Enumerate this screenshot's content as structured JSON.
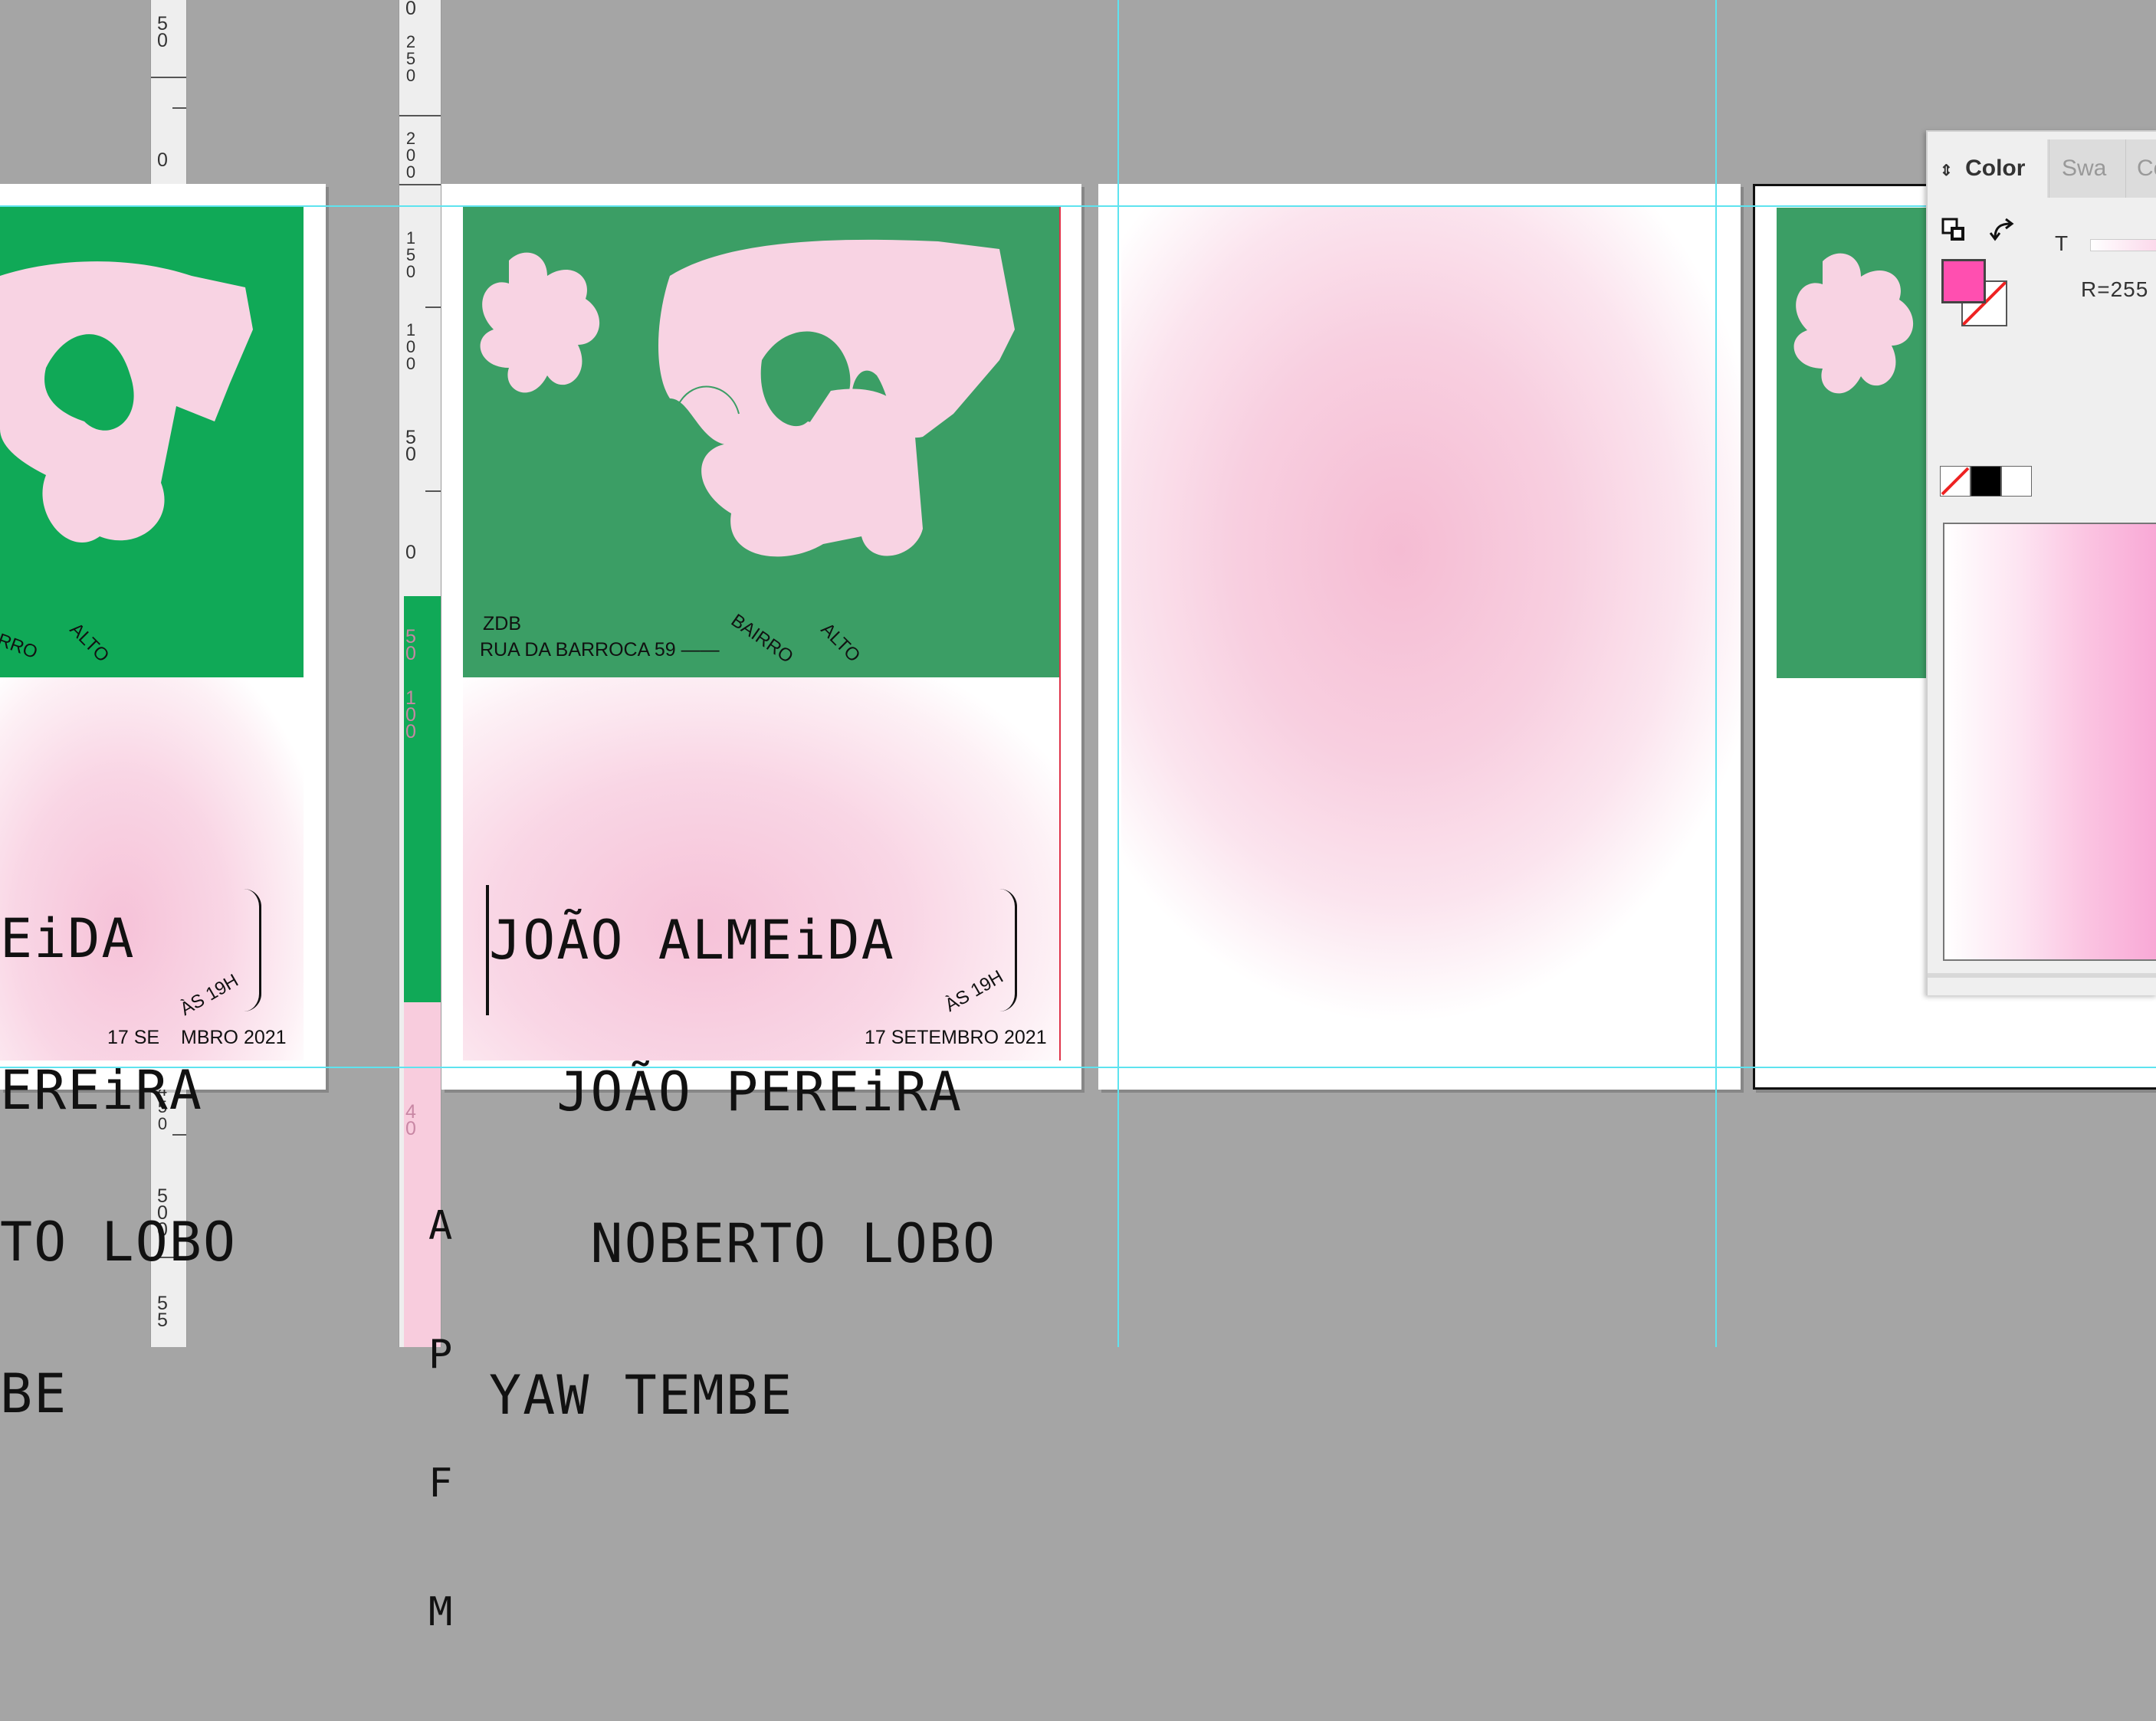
{
  "rulers": {
    "left_labels": [
      "5 0",
      "0",
      "4 5 0",
      "5 0 0",
      "5 5"
    ],
    "mid_labels": [
      "0",
      "2 5 0",
      "2 0 0",
      "1 5 0",
      "1 0 0",
      "5 0",
      "0",
      "5 0",
      "1 0 0",
      "4 0"
    ]
  },
  "poster": {
    "venue": "ZDB",
    "address": "RUA DA BARROCA 59 ——",
    "neighborhood_1": "BAIRRO",
    "neighborhood_2": "ALTO",
    "names": [
      "JOÃO ALMEiDA",
      "  JOÃO PEREiRA",
      "   NOBERTO LOBO",
      "YAW TEMBE"
    ],
    "time": "ÀS 19H",
    "date": "17 SETEMBRO 2021"
  },
  "poster_left": {
    "neighborhood_1": "RRO",
    "neighborhood_2": "ALTO",
    "names": [
      "EiDA",
      "EREiRA",
      "TO LOBO",
      "BE"
    ],
    "date_left": "17 SE",
    "date_right": "MBRO 2021",
    "time": "ÀS 19H"
  },
  "overflow_text": [
    "A",
    "P",
    "F",
    "M"
  ],
  "color_panel": {
    "tabs": [
      "Color",
      "Swa",
      "Co"
    ],
    "tint_label": "T",
    "rgb_readout": "R=255",
    "fill_color": "#ff4fb0",
    "fill_stroke_swap_icon": "swap-icon",
    "default_colors_icon": "reset-icon"
  },
  "colors": {
    "pasteboard": "#a5a5a5",
    "poster_green": "#3b9e65",
    "guide": "#5ee3ef",
    "pink": "#f7c6db"
  }
}
